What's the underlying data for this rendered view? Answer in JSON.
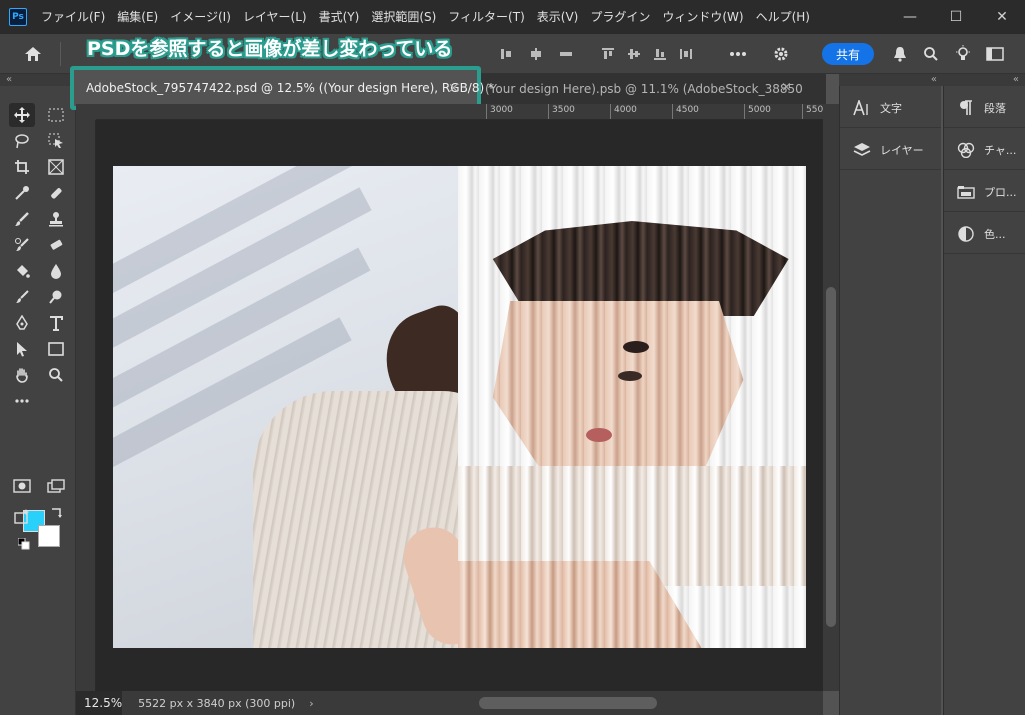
{
  "app": {
    "logo_text": "Ps",
    "menu": [
      "ファイル(F)",
      "編集(E)",
      "イメージ(I)",
      "レイヤー(L)",
      "書式(Y)",
      "選択範囲(S)",
      "フィルター(T)",
      "表示(V)",
      "プラグイン",
      "ウィンドウ(W)",
      "ヘルプ(H)"
    ],
    "window_controls": {
      "minimize": "—",
      "maximize": "☐",
      "close": "✕"
    }
  },
  "options_bar": {
    "share_label": "共有"
  },
  "annotation": {
    "text": "PSDを参照すると画像が差し変わっている",
    "color": "#2a9d8f"
  },
  "tabs": {
    "active": {
      "label": "AdobeStock_795747422.psd @ 12.5% ((Your design Here), RGB/8) *",
      "close": "×"
    },
    "inactive": {
      "label": "(Your design Here).psb @ 11.1% (AdobeStock_38850...",
      "close": "×"
    }
  },
  "ruler": {
    "top_ticks": [
      "3000",
      "3500",
      "4000",
      "4500",
      "5000",
      "550"
    ]
  },
  "colors": {
    "foreground": "#29d0fa",
    "background": "#ffffff",
    "accent": "#1473e6"
  },
  "status": {
    "zoom": "12.5%",
    "doc_info": "5522 px x 3840 px (300 ppi)",
    "arrow": "›"
  },
  "panels": {
    "col1": [
      {
        "icon": "character-icon",
        "label": "文字"
      },
      {
        "icon": "layers-icon",
        "label": "レイヤー"
      }
    ],
    "col2": [
      {
        "icon": "paragraph-icon",
        "label": "段落"
      },
      {
        "icon": "channels-icon",
        "label": "チャ..."
      },
      {
        "icon": "properties-icon",
        "label": "プロ..."
      },
      {
        "icon": "color-icon",
        "label": "色..."
      }
    ]
  },
  "tools": [
    "move-tool",
    "marquee-tool",
    "lasso-tool",
    "object-select-tool",
    "crop-tool",
    "frame-tool",
    "eyedropper-tool",
    "healing-brush-tool",
    "brush-tool",
    "clone-stamp-tool",
    "history-brush-tool",
    "eraser-tool",
    "paint-bucket-tool",
    "blur-tool",
    "dodge-tool",
    "zoom-lens-tool",
    "pen-tool",
    "type-tool",
    "path-select-tool",
    "rectangle-tool",
    "hand-tool",
    "zoom-tool",
    "more-tools"
  ]
}
